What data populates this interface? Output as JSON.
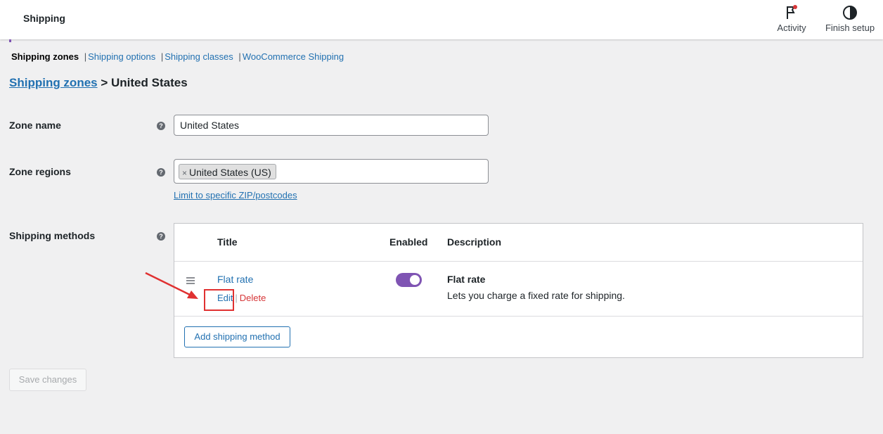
{
  "header": {
    "title": "Shipping",
    "actions": [
      {
        "label": "Activity",
        "icon": "flag-icon"
      },
      {
        "label": "Finish setup",
        "icon": "half-circle-icon"
      }
    ]
  },
  "subnav": {
    "current": "Shipping zones",
    "links": [
      "Shipping options",
      "Shipping classes",
      "WooCommerce Shipping"
    ]
  },
  "breadcrumb": {
    "parent": "Shipping zones",
    "separator": ">",
    "current": "United States"
  },
  "form": {
    "zone_name_label": "Zone name",
    "zone_name_value": "United States",
    "zone_regions_label": "Zone regions",
    "region_chip": "United States (US)",
    "region_chip_remove": "×",
    "limit_link": "Limit to specific ZIP/postcodes",
    "shipping_methods_label": "Shipping methods",
    "help_glyph": "?"
  },
  "methods_table": {
    "headers": {
      "title": "Title",
      "enabled": "Enabled",
      "description": "Description"
    },
    "rows": [
      {
        "title": "Flat rate",
        "edit": "Edit",
        "separator": "|",
        "delete": "Delete",
        "enabled": true,
        "desc_title": "Flat rate",
        "desc_text": "Lets you charge a fixed rate for shipping."
      }
    ],
    "add_button": "Add shipping method"
  },
  "save_button": "Save changes",
  "colors": {
    "accent": "#7f54b3",
    "link": "#2271b1",
    "danger": "#d63638",
    "annotation": "#e03131"
  }
}
